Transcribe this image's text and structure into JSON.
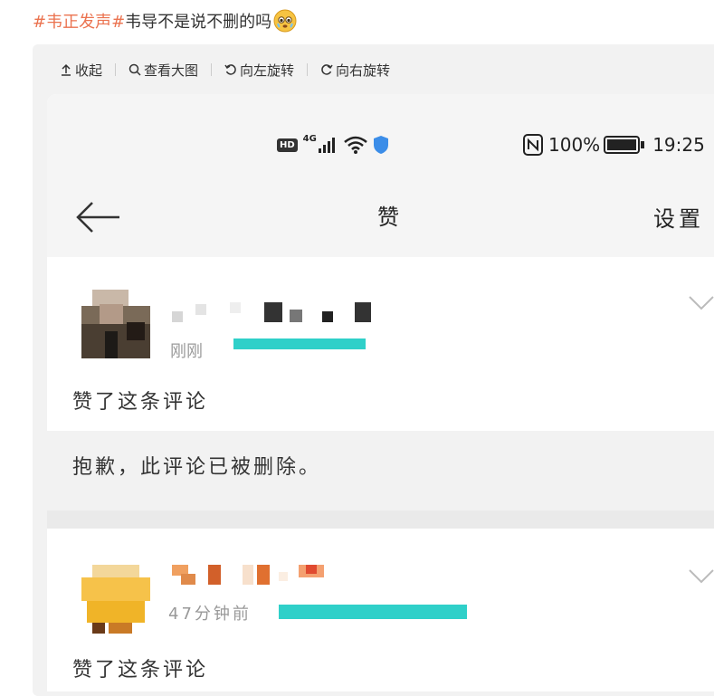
{
  "post": {
    "hashtag": "#韦正发声#",
    "text": "韦导不是说不删的吗",
    "emoji": "crying-face-emoji"
  },
  "toolbar": {
    "collapse": "收起",
    "view_large": "查看大图",
    "rotate_left": "向左旋转",
    "rotate_right": "向右旋转"
  },
  "phone": {
    "status": {
      "hd": "HD",
      "network": "4G",
      "battery": "100%",
      "time": "19:25"
    },
    "nav": {
      "title": "赞",
      "settings": "设置"
    },
    "items": [
      {
        "time": "刚刚",
        "action": "赞了这条评论",
        "deleted_notice": "抱歉，此评论已被删除。"
      },
      {
        "time": "47分钟前",
        "action": "赞了这条评论"
      }
    ]
  },
  "colors": {
    "accent": "#eb7350",
    "cyan": "#2fd0c9",
    "shield": "#3b8de8"
  }
}
